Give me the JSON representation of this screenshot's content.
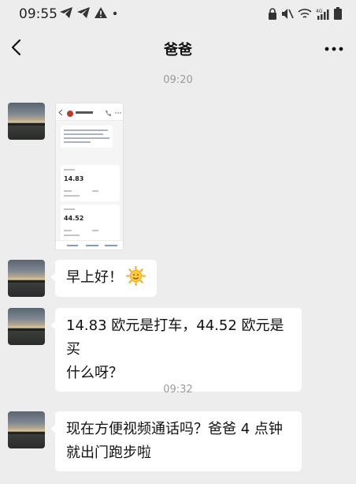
{
  "status_bar": {
    "time": "09:55",
    "left_icons": [
      "telegram-icon",
      "telegram-icon",
      "alert-triangle-icon",
      "dot-icon"
    ],
    "right_icons": [
      "lock-icon",
      "mute-icon",
      "wifi-icon",
      "4g-signal-icon",
      "battery-icon"
    ],
    "network_label": "4G"
  },
  "nav": {
    "title": "爸爸",
    "back_icon": "chevron-left-icon",
    "more_icon": "more-icon"
  },
  "messages": [
    {
      "type": "timestamp",
      "text": "09:20"
    },
    {
      "type": "image",
      "sender": "爸爸",
      "screenshot": {
        "bank_name": "招商银行",
        "amounts": [
          "14.83",
          "44.52"
        ]
      }
    },
    {
      "type": "text",
      "sender": "爸爸",
      "text": "早上好！",
      "emoji": "sun-face-emoji"
    },
    {
      "type": "text",
      "sender": "爸爸",
      "lines": [
        "14.83 欧元是打车，44.52 欧元是买",
        "什么呀？"
      ]
    },
    {
      "type": "timestamp",
      "text": "09:32"
    },
    {
      "type": "text",
      "sender": "爸爸",
      "lines": [
        "现在方便视频通话吗？爸爸 4 点钟",
        "就出门跑步啦"
      ]
    }
  ],
  "colors": {
    "background": "#ededed",
    "bubble": "#ffffff",
    "timestamp": "#9a9a9a"
  }
}
